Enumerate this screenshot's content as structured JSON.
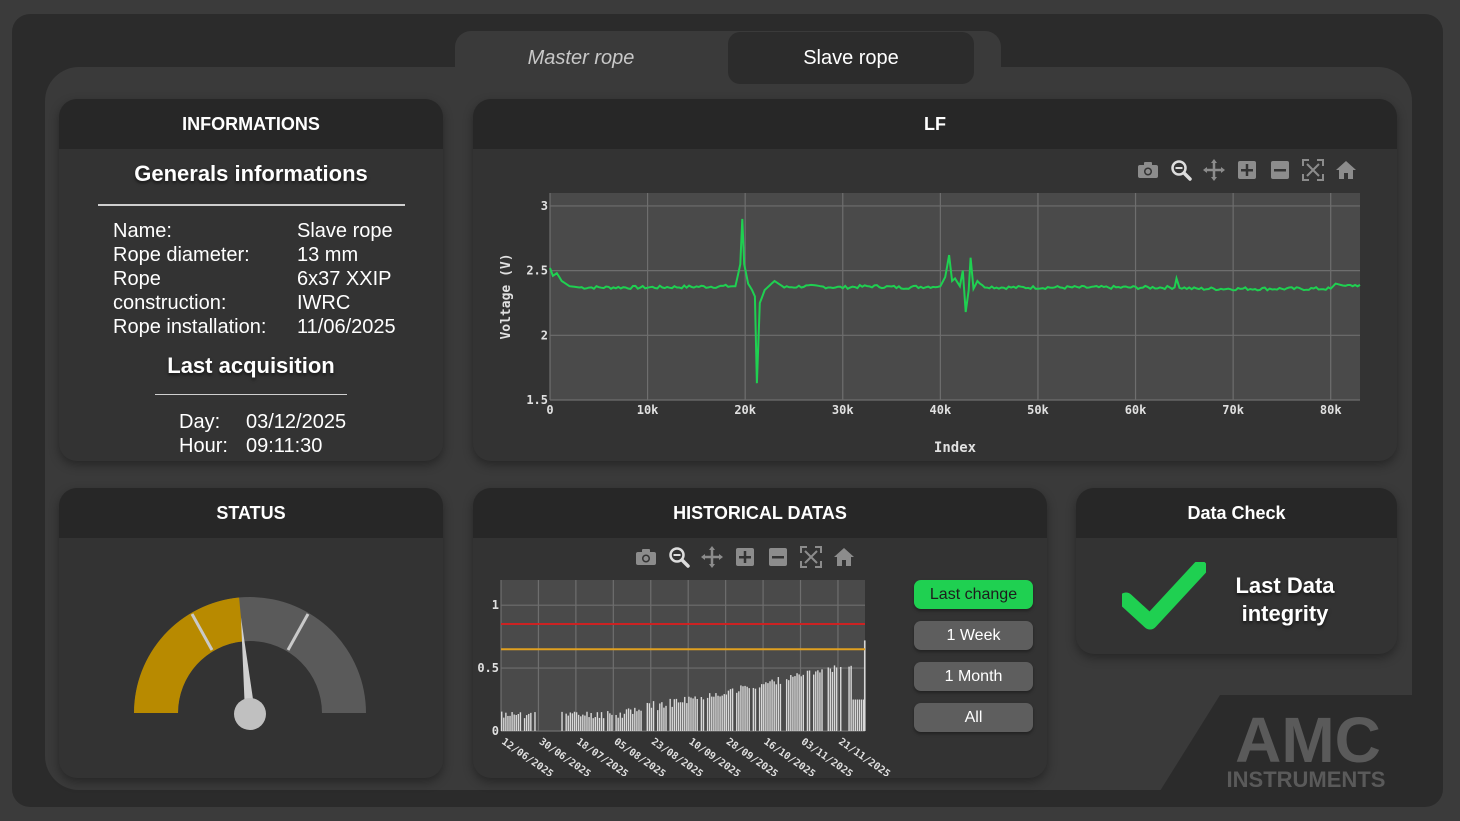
{
  "tabs": {
    "master": "Master rope",
    "slave": "Slave rope"
  },
  "info": {
    "header": "INFORMATIONS",
    "general_title": "Generals informations",
    "labels": {
      "name": "Name:",
      "diameter": "Rope diameter:",
      "construction_1": "Rope",
      "construction_2": "construction:",
      "installation": "Rope installation:"
    },
    "values": {
      "name": "Slave rope",
      "diameter": "13 mm",
      "construction_1": "6x37 XXIP",
      "construction_2": "IWRC",
      "installation": "11/06/2025"
    },
    "last_title": "Last acquisition",
    "day_label": "Day:",
    "day": "03/12/2025",
    "hour_label": "Hour:",
    "hour": "09:11:30"
  },
  "lf": {
    "header": "LF"
  },
  "status": {
    "header": "STATUS",
    "gauge_value": 0.47,
    "colors": {
      "fill": "#b88a00",
      "track": "#5a5a5a"
    }
  },
  "historical": {
    "header": "HISTORICAL DATAS",
    "buttons": {
      "last_change": "Last change",
      "week": "1 Week",
      "month": "1 Month",
      "all": "All"
    }
  },
  "datacheck": {
    "header": "Data Check",
    "line1": "Last Data",
    "line2": "integrity",
    "check_color": "#1fd051"
  },
  "logo": {
    "name": "AMC",
    "sub": "INSTRUMENTS"
  },
  "icons": [
    "camera-icon",
    "zoom-icon",
    "pan-icon",
    "zoom-in-icon",
    "zoom-out-icon",
    "autoscale-icon",
    "home-icon"
  ],
  "chart_data": [
    {
      "type": "line",
      "xlabel": "Index",
      "ylabel": "Voltage (V)",
      "xlim": [
        0,
        83000
      ],
      "ylim": [
        1.5,
        3.1
      ],
      "xticks": [
        0,
        10000,
        20000,
        30000,
        40000,
        50000,
        60000,
        70000,
        80000
      ],
      "xtick_labels": [
        "0",
        "10k",
        "20k",
        "30k",
        "40k",
        "50k",
        "60k",
        "70k",
        "80k"
      ],
      "yticks": [
        1.5,
        2,
        2.5,
        3
      ],
      "ytick_labels": [
        "1.5",
        "2",
        "2.5",
        "3"
      ],
      "grid": true,
      "color": "#1fd051",
      "baseline": 2.37,
      "x": [
        0,
        300,
        700,
        1200,
        2000,
        3000,
        10000,
        19000,
        19500,
        19700,
        19900,
        20300,
        20700,
        21000,
        21200,
        21500,
        22000,
        23000,
        24000,
        26000,
        30000,
        33000,
        36000,
        40000,
        40500,
        40900,
        41200,
        41500,
        42000,
        42300,
        42600,
        42900,
        43100,
        43400,
        43800,
        44300,
        46000,
        52000,
        60000,
        64000,
        64200,
        64500,
        66000,
        72000,
        80000,
        80500,
        81500,
        83000
      ],
      "y": [
        2.52,
        2.46,
        2.48,
        2.42,
        2.38,
        2.37,
        2.37,
        2.38,
        2.55,
        2.9,
        2.55,
        2.4,
        2.35,
        2.3,
        1.63,
        2.25,
        2.35,
        2.42,
        2.37,
        2.38,
        2.37,
        2.38,
        2.37,
        2.38,
        2.45,
        2.62,
        2.42,
        2.44,
        2.38,
        2.5,
        2.18,
        2.35,
        2.6,
        2.36,
        2.42,
        2.38,
        2.37,
        2.37,
        2.37,
        2.37,
        2.44,
        2.37,
        2.36,
        2.36,
        2.36,
        2.4,
        2.38,
        2.39
      ]
    },
    {
      "type": "bar",
      "xlim": [
        0,
        175
      ],
      "ylim": [
        0,
        1.2
      ],
      "yticks": [
        0,
        0.5,
        1
      ],
      "ytick_labels": [
        "0",
        "0.5",
        "1"
      ],
      "xtick_labels": [
        "12/06/2025",
        "30/06/2025",
        "18/07/2025",
        "05/08/2025",
        "23/08/2025",
        "10/09/2025",
        "28/09/2025",
        "16/10/2025",
        "03/11/2025",
        "21/11/2025"
      ],
      "thresholds": [
        {
          "value": 0.85,
          "color": "#cc2222"
        },
        {
          "value": 0.65,
          "color": "#e0a020"
        }
      ],
      "grid": true,
      "bar_color": "#d8d8d8"
    }
  ]
}
